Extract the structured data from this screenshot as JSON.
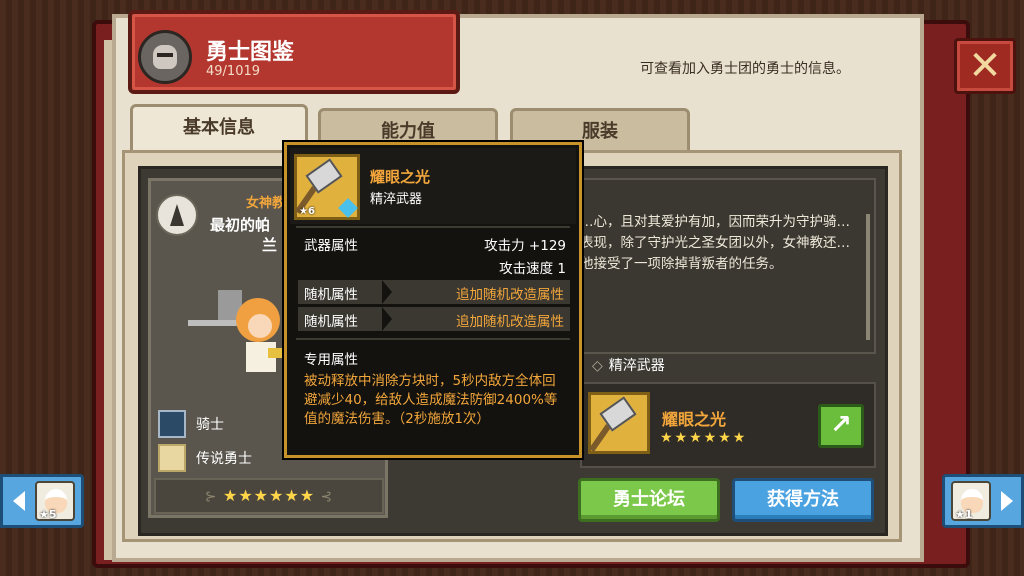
{
  "header": {
    "title": "勇士图鉴",
    "count": "49/1019",
    "description": "可查看加入勇士团的勇士的信息。"
  },
  "tabs": [
    {
      "label": "基本信息",
      "active": true
    },
    {
      "label": "能力值",
      "active": false
    },
    {
      "label": "服装",
      "active": false
    }
  ],
  "hero": {
    "affiliation": "女神教",
    "name_line1": "最初的帕",
    "name_line2": "兰",
    "class": "骑士",
    "rank": "传说勇士",
    "stars": "★★★★★★"
  },
  "story": {
    "text": "…心，且对其爱护有加，因而荣升为守护骑…表现，除了守护光之圣女团以外，女神教还…他接受了一项除掉背叛者的任务。"
  },
  "weapon_section": {
    "label": "精淬武器",
    "name": "耀眼之光",
    "stars": "★★★★★★"
  },
  "buttons": {
    "forum": "勇士论坛",
    "obtain": "获得方法",
    "close": "✕",
    "go": "↗"
  },
  "nav": {
    "left_badge": "★5",
    "right_badge": "★1"
  },
  "tooltip": {
    "weapon_name": "耀眼之光",
    "weapon_type": "精淬武器",
    "weapon_level": "★6",
    "attr_label": "武器属性",
    "attr_attack": "攻击力 +129",
    "attr_speed": "攻击速度 1",
    "random1_label": "随机属性",
    "random1_value": "追加随机改造属性",
    "random2_label": "随机属性",
    "random2_value": "追加随机改造属性",
    "exclusive_label": "专用属性",
    "exclusive_text": "被动释放中消除方块时，5秒内敌方全体回避减少40，给敌人造成魔法防御2400%等值的魔法伤害。（2秒施放1次）"
  }
}
